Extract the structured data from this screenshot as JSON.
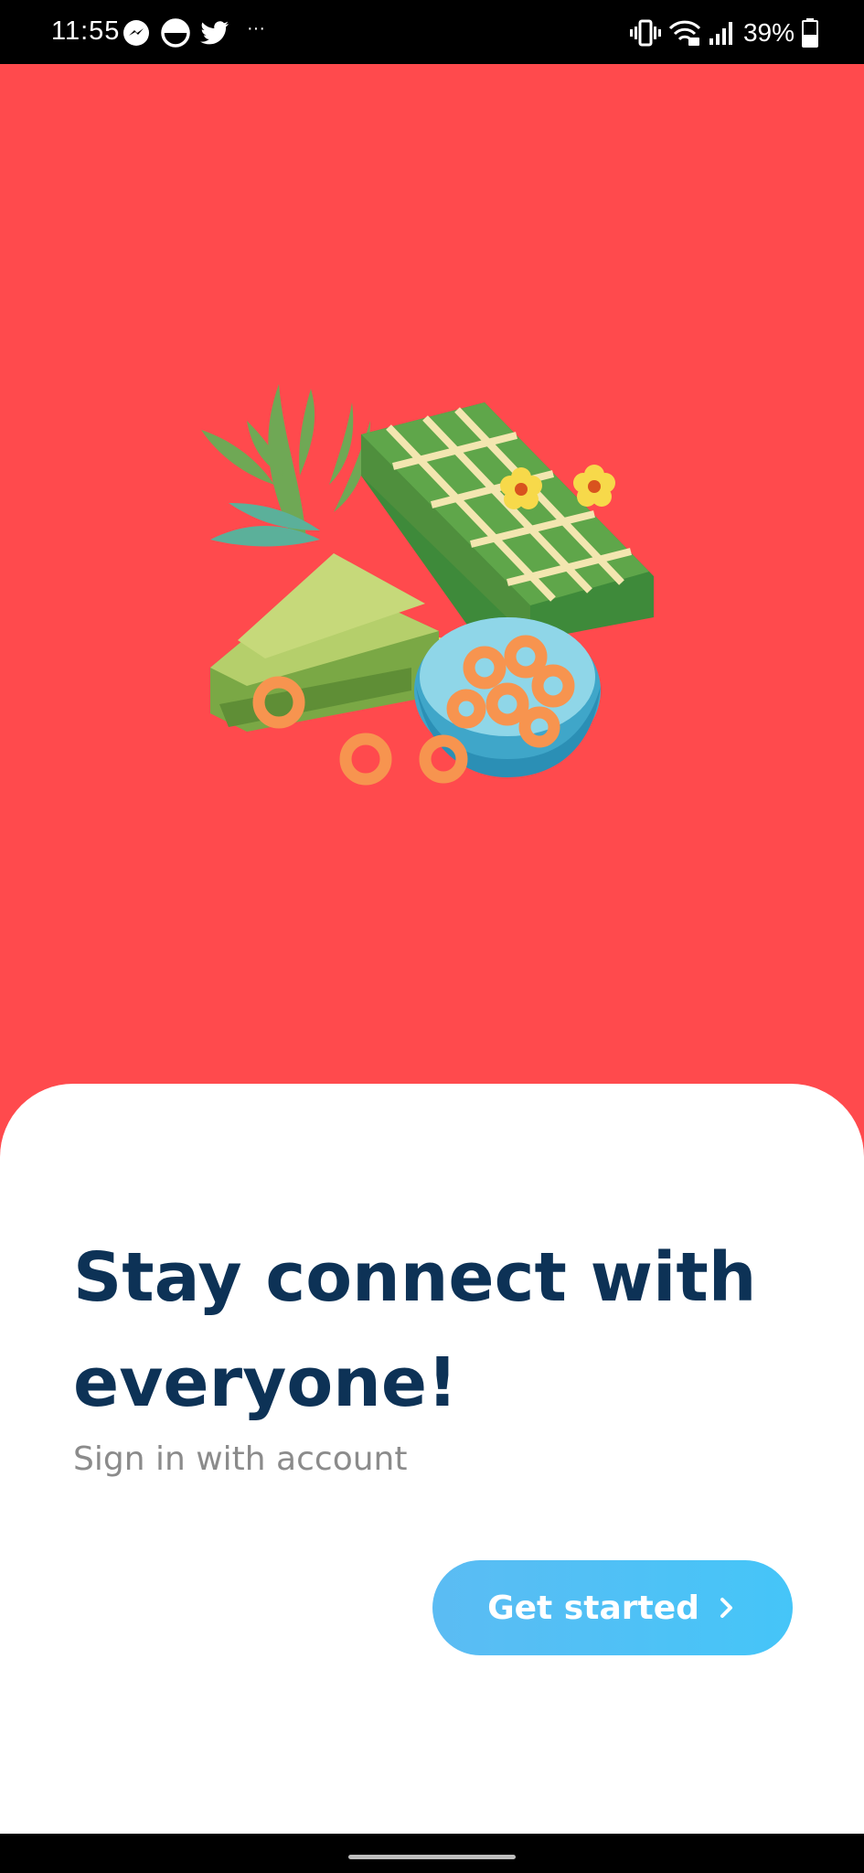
{
  "status_bar": {
    "time": "11:55",
    "more_indicator": "···",
    "battery_percent": "39%",
    "left_icons": [
      "messenger-icon",
      "do-not-disturb-icon",
      "twitter-icon"
    ],
    "right_icons": [
      "vibrate-icon",
      "wifi-icon",
      "signal-icon",
      "battery-icon"
    ]
  },
  "illustration": {
    "icon": "food-illustration-icon"
  },
  "sheet": {
    "headline": "Stay connect with everyone!",
    "subtitle": "Sign in with account",
    "cta_label": "Get started",
    "cta_icon": "chevron-right-icon"
  },
  "colors": {
    "background_red": "#ff4a4d",
    "headline_navy": "#0d3256",
    "subtitle_gray": "#8b8b8b",
    "cta_blue": "#4fc2f7"
  }
}
